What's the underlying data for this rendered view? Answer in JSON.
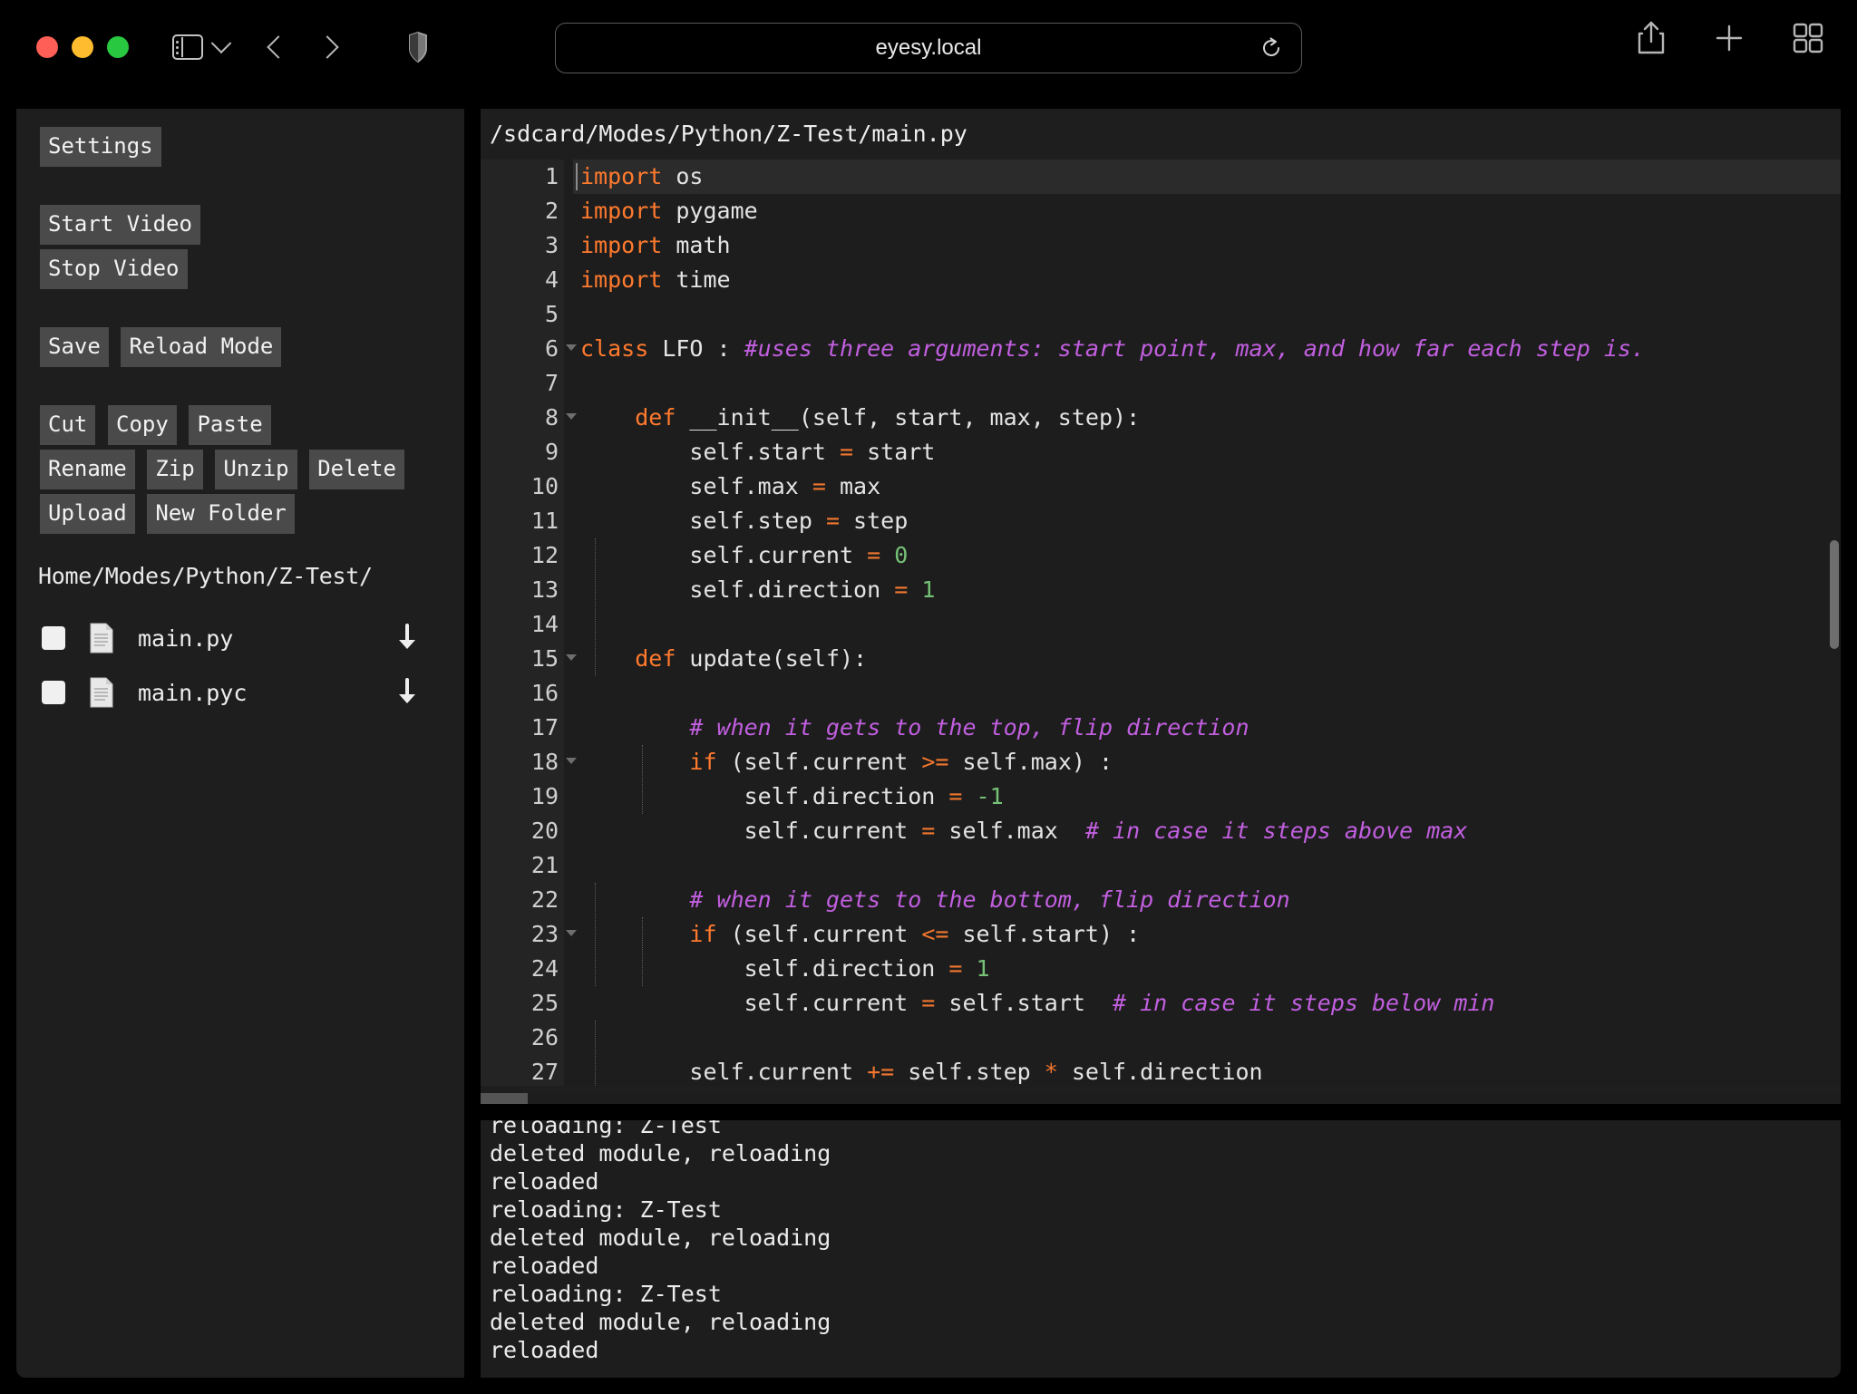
{
  "browser": {
    "url": "eyesy.local",
    "icons": {
      "sidebar": "sidebar-toggle-icon",
      "chevron_down": "chevron-down-icon",
      "back": "back-arrow-icon",
      "forward": "forward-arrow-icon",
      "shield": "privacy-shield-icon",
      "reload": "reload-icon",
      "share": "share-icon",
      "new_tab": "plus-icon",
      "tab_overview": "tab-overview-icon"
    }
  },
  "sidebar": {
    "settings_button": "Settings",
    "start_video_button": "Start Video",
    "stop_video_button": "Stop Video",
    "save_button": "Save",
    "reload_mode_button": "Reload Mode",
    "cut_button": "Cut",
    "copy_button": "Copy",
    "paste_button": "Paste",
    "rename_button": "Rename",
    "zip_button": "Zip",
    "unzip_button": "Unzip",
    "delete_button": "Delete",
    "upload_button": "Upload",
    "new_folder_button": "New Folder",
    "current_path": "Home/Modes/Python/Z-Test/",
    "files": [
      {
        "name": "main.py"
      },
      {
        "name": "main.pyc"
      }
    ]
  },
  "editor": {
    "file_path": "/sdcard/Modes/Python/Z-Test/main.py",
    "active_line": 1,
    "lines": [
      {
        "n": "1",
        "fold": false,
        "tokens": [
          {
            "t": "import",
            "c": "kw"
          },
          {
            "t": " os",
            "c": ""
          }
        ]
      },
      {
        "n": "2",
        "fold": false,
        "tokens": [
          {
            "t": "import",
            "c": "kw"
          },
          {
            "t": " pygame",
            "c": ""
          }
        ]
      },
      {
        "n": "3",
        "fold": false,
        "tokens": [
          {
            "t": "import",
            "c": "kw"
          },
          {
            "t": " math",
            "c": ""
          }
        ]
      },
      {
        "n": "4",
        "fold": false,
        "tokens": [
          {
            "t": "import",
            "c": "kw"
          },
          {
            "t": " time",
            "c": ""
          }
        ]
      },
      {
        "n": "5",
        "fold": false,
        "tokens": []
      },
      {
        "n": "6",
        "fold": true,
        "tokens": [
          {
            "t": "class",
            "c": "kw"
          },
          {
            "t": " LFO : ",
            "c": ""
          },
          {
            "t": "#uses three arguments: start point, max, and how far each step is.",
            "c": "cmt"
          }
        ]
      },
      {
        "n": "7",
        "fold": false,
        "tokens": []
      },
      {
        "n": "8",
        "fold": true,
        "tokens": [
          {
            "t": "    ",
            "c": ""
          },
          {
            "t": "def",
            "c": "kw"
          },
          {
            "t": " __init__(self, start, max, step):",
            "c": ""
          }
        ]
      },
      {
        "n": "9",
        "fold": false,
        "tokens": [
          {
            "t": "        self.start ",
            "c": ""
          },
          {
            "t": "=",
            "c": "op"
          },
          {
            "t": " start",
            "c": ""
          }
        ]
      },
      {
        "n": "10",
        "fold": false,
        "tokens": [
          {
            "t": "        self.max ",
            "c": ""
          },
          {
            "t": "=",
            "c": "op"
          },
          {
            "t": " max",
            "c": ""
          }
        ]
      },
      {
        "n": "11",
        "fold": false,
        "tokens": [
          {
            "t": "        self.step ",
            "c": ""
          },
          {
            "t": "=",
            "c": "op"
          },
          {
            "t": " step",
            "c": ""
          }
        ]
      },
      {
        "n": "12",
        "fold": false,
        "tokens": [
          {
            "t": "        self.current ",
            "c": ""
          },
          {
            "t": "=",
            "c": "op"
          },
          {
            "t": " ",
            "c": ""
          },
          {
            "t": "0",
            "c": "num"
          }
        ]
      },
      {
        "n": "13",
        "fold": false,
        "tokens": [
          {
            "t": "        self.direction ",
            "c": ""
          },
          {
            "t": "=",
            "c": "op"
          },
          {
            "t": " ",
            "c": ""
          },
          {
            "t": "1",
            "c": "num"
          }
        ]
      },
      {
        "n": "14",
        "fold": false,
        "tokens": []
      },
      {
        "n": "15",
        "fold": true,
        "tokens": [
          {
            "t": "    ",
            "c": ""
          },
          {
            "t": "def",
            "c": "kw"
          },
          {
            "t": " update(self):",
            "c": ""
          }
        ]
      },
      {
        "n": "16",
        "fold": false,
        "tokens": []
      },
      {
        "n": "17",
        "fold": false,
        "tokens": [
          {
            "t": "        ",
            "c": ""
          },
          {
            "t": "# when it gets to the top, flip direction",
            "c": "cmt"
          }
        ]
      },
      {
        "n": "18",
        "fold": true,
        "tokens": [
          {
            "t": "        ",
            "c": ""
          },
          {
            "t": "if",
            "c": "kw"
          },
          {
            "t": " (self.current ",
            "c": ""
          },
          {
            "t": ">=",
            "c": "op"
          },
          {
            "t": " self.max) :",
            "c": ""
          }
        ]
      },
      {
        "n": "19",
        "fold": false,
        "tokens": [
          {
            "t": "            self.direction ",
            "c": ""
          },
          {
            "t": "=",
            "c": "op"
          },
          {
            "t": " ",
            "c": ""
          },
          {
            "t": "-1",
            "c": "num"
          }
        ]
      },
      {
        "n": "20",
        "fold": false,
        "tokens": [
          {
            "t": "            self.current ",
            "c": ""
          },
          {
            "t": "=",
            "c": "op"
          },
          {
            "t": " self.max  ",
            "c": ""
          },
          {
            "t": "# in case it steps above max",
            "c": "cmt"
          }
        ]
      },
      {
        "n": "21",
        "fold": false,
        "tokens": []
      },
      {
        "n": "22",
        "fold": false,
        "tokens": [
          {
            "t": "        ",
            "c": ""
          },
          {
            "t": "# when it gets to the bottom, flip direction",
            "c": "cmt"
          }
        ]
      },
      {
        "n": "23",
        "fold": true,
        "tokens": [
          {
            "t": "        ",
            "c": ""
          },
          {
            "t": "if",
            "c": "kw"
          },
          {
            "t": " (self.current ",
            "c": ""
          },
          {
            "t": "<=",
            "c": "op"
          },
          {
            "t": " self.start) :",
            "c": ""
          }
        ]
      },
      {
        "n": "24",
        "fold": false,
        "tokens": [
          {
            "t": "            self.direction ",
            "c": ""
          },
          {
            "t": "=",
            "c": "op"
          },
          {
            "t": " ",
            "c": ""
          },
          {
            "t": "1",
            "c": "num"
          }
        ]
      },
      {
        "n": "25",
        "fold": false,
        "tokens": [
          {
            "t": "            self.current ",
            "c": ""
          },
          {
            "t": "=",
            "c": "op"
          },
          {
            "t": " self.start  ",
            "c": ""
          },
          {
            "t": "# in case it steps below min",
            "c": "cmt"
          }
        ]
      },
      {
        "n": "26",
        "fold": false,
        "tokens": []
      },
      {
        "n": "27",
        "fold": false,
        "tokens": [
          {
            "t": "        self.current ",
            "c": ""
          },
          {
            "t": "+=",
            "c": "op"
          },
          {
            "t": " self.step ",
            "c": ""
          },
          {
            "t": "*",
            "c": "op"
          },
          {
            "t": " self.direction",
            "c": ""
          }
        ]
      }
    ]
  },
  "console": {
    "lines": [
      "reloading: Z-Test",
      "deleted module, reloading",
      "reloaded",
      "reloading: Z-Test",
      "deleted module, reloading",
      "reloaded",
      "reloading: Z-Test",
      "deleted module, reloading",
      "reloaded"
    ]
  },
  "colors": {
    "keyword": "#ff7a2e",
    "operator": "#f2762e",
    "number": "#76c176",
    "comment": "#c25fe0",
    "editor_bg": "#1d1d1d",
    "sidebar_bg": "#1e1e1e",
    "button_bg": "#4a4a4a"
  }
}
